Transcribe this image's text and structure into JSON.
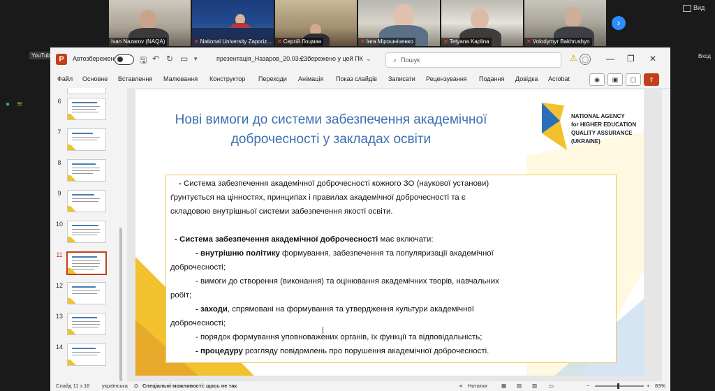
{
  "meeting": {
    "participants": [
      {
        "name": "Ivan Nazarov (NAQA)"
      },
      {
        "name": "National University Zaporiz..."
      },
      {
        "name": "Сергій Лоцман"
      },
      {
        "name": "Інга Мірошніченко"
      },
      {
        "name": "Tetyana Kaplina"
      },
      {
        "name": "Volodymyr Bakhrushyn"
      }
    ],
    "view_label": "Вид",
    "exit_label": "Вход",
    "youtube_label": "YouTube"
  },
  "titlebar": {
    "autosave_label": "Автозбереження",
    "filename": "презентація_Назаров_20.03.2...",
    "saved_status": "• Збережено у цей ПК",
    "search_placeholder": "Пошук"
  },
  "ribbon": {
    "tabs": [
      "Файл",
      "Основне",
      "Вставлення",
      "Малювання",
      "Конструктор",
      "Переходи",
      "Анімація",
      "Показ слайдів",
      "Записати",
      "Рецензування",
      "Подання",
      "Довідка",
      "Acrobat"
    ]
  },
  "thumbnails": {
    "numbers": [
      "6",
      "7",
      "8",
      "9",
      "10",
      "11",
      "12",
      "13",
      "14"
    ],
    "selected": "11"
  },
  "slide": {
    "title_line1": "Нові вимоги до системи забезпечення академічної",
    "title_line2": "доброчесності у закладах освіти",
    "logo_lines": [
      "NATIONAL AGENCY",
      "for HIGHER EDUCATION",
      "QUALITY ASSURANCE",
      "(UKRAINE)"
    ],
    "body": {
      "p1_dash": "- ",
      "p1_line1": "Система забезпечення академічної доброчесності кожного ЗО (наукової установи)",
      "p1_line2": "ґрунтується на цінностях, принципах і правилах академічної доброчесності та є",
      "p1_line3": "складовою внутрішньої системи забезпечення якості освіти.",
      "p2_dash": "-  ",
      "p2_bold": "Система забезпечення академічної доброчесності",
      "p2_rest": " має включати:",
      "i1_bold": "- внутрішню політику",
      "i1_rest": " формування, забезпечення та популяризації академічної",
      "i1_line2": "доброчесності;",
      "i2_line1": "- вимоги до створення (виконання) та оцінювання академічних творів, навчальних",
      "i2_line2": "робіт;",
      "i3_bold": "- заходи",
      "i3_rest": ", спрямовані на формування та утвердження культури академічної",
      "i3_line2": "доброчесності;",
      "i4": "- порядок формування уповноважених органів, їх функції та відповідальність;",
      "i5_bold": "- процедуру",
      "i5_rest": " розгляду повідомлень про порушення академічної доброчесності."
    }
  },
  "status": {
    "slide_counter": "Слайд 11 з 16",
    "language": "українська",
    "accessibility": "Спеціальні можливості: щось не так",
    "notes_label": "Нотатки",
    "zoom": "83%"
  },
  "colors": {
    "title": "#3b6fb0",
    "accent_yellow": "#f2c12e",
    "accent_blue": "#2a6fb8",
    "ppt_red": "#c43e1c"
  }
}
